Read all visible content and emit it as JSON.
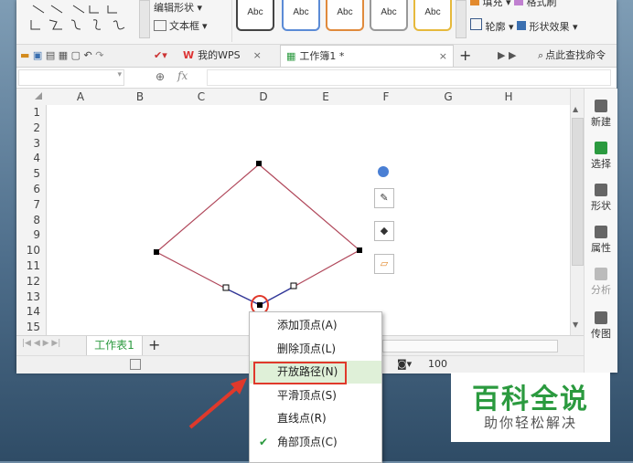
{
  "ribbon": {
    "edit_shape_label": "编辑形状",
    "textbox_label": "文本框",
    "style_boxes": [
      "Abc",
      "Abc",
      "Abc",
      "Abc",
      "Abc"
    ],
    "fill_label": "填充",
    "preset_label": "格式刷",
    "outline_label": "轮廓",
    "shape_effect_label": "形状效果"
  },
  "tabs": {
    "wps_tab": "我的WPS",
    "workbook_tab": "工作簿1 *",
    "add_tab": "+",
    "search_label": "点此查找命令"
  },
  "formula": {
    "fx_label": "fx"
  },
  "columns": [
    "A",
    "B",
    "C",
    "D",
    "E",
    "F",
    "G",
    "H"
  ],
  "rows": [
    "1",
    "2",
    "3",
    "4",
    "5",
    "6",
    "7",
    "8",
    "9",
    "10",
    "11",
    "12",
    "13",
    "14",
    "15"
  ],
  "right_panel": [
    {
      "label": "新建",
      "icon": "new-icon"
    },
    {
      "label": "选择",
      "icon": "select-icon"
    },
    {
      "label": "形状",
      "icon": "shape-icon"
    },
    {
      "label": "属性",
      "icon": "property-icon"
    },
    {
      "label": "分析",
      "icon": "analyze-icon"
    },
    {
      "label": "传图",
      "icon": "upload-image-icon"
    }
  ],
  "sheet_bar": {
    "sheet_name": "工作表1",
    "add_sheet": "+"
  },
  "status": {
    "zoom": "100"
  },
  "context_menu": {
    "items": [
      {
        "label": "添加顶点(A)",
        "checked": false,
        "highlighted": false
      },
      {
        "label": "删除顶点(L)",
        "checked": false,
        "highlighted": false
      },
      {
        "label": "开放路径(N)",
        "checked": false,
        "highlighted": true
      },
      {
        "label": "平滑顶点(S)",
        "checked": false,
        "highlighted": false
      },
      {
        "label": "直线点(R)",
        "checked": false,
        "highlighted": false
      },
      {
        "label": "角部顶点(C)",
        "checked": true,
        "highlighted": false
      }
    ]
  },
  "watermark": {
    "title": "百科全说",
    "subtitle": "助你轻松解决"
  },
  "colors": {
    "highlight_box": "#e0392b",
    "shape_line": "#b0475a",
    "accent_green": "#2b9a3f",
    "arrow": "#e0392b"
  }
}
